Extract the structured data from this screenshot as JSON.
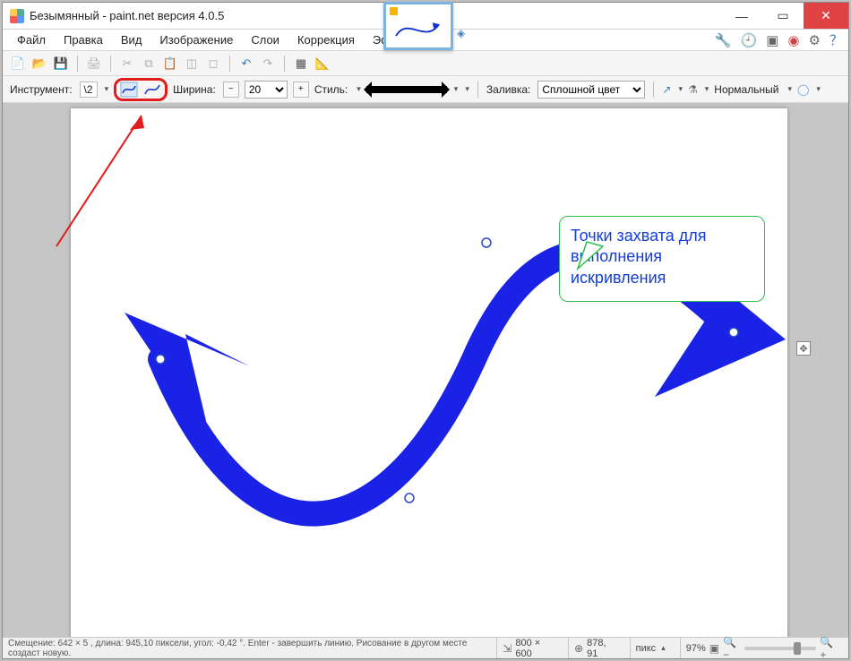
{
  "window_title": "Безымянный - paint.net версия 4.0.5",
  "menus": [
    "Файл",
    "Правка",
    "Вид",
    "Изображение",
    "Слои",
    "Коррекция",
    "Эффекты"
  ],
  "right_icons": [
    "tool-icon",
    "clock-icon",
    "layers-icon",
    "palette-icon",
    "gear-icon",
    "help-icon"
  ],
  "toolbar2": {
    "instrument_label": "Инструмент:",
    "instrument_value": "\\2",
    "width_label": "Ширина:",
    "width_value": "20",
    "style_label": "Стиль:",
    "fill_label": "Заливка:",
    "fill_value": "Сплошной цвет",
    "blend_label": "Нормальный"
  },
  "callout_text": "Точки захвата для выполнения искривления",
  "statusbar": {
    "hint": "Смещение: 642 × 5 , длина: 945,10 пиксели, угол: -0,42 °. Enter - завершить линию. Рисование в другом месте создаст новую.",
    "dims": "800 × 600",
    "cursor": "878, 91",
    "unit": "пикс",
    "zoom": "97%"
  }
}
